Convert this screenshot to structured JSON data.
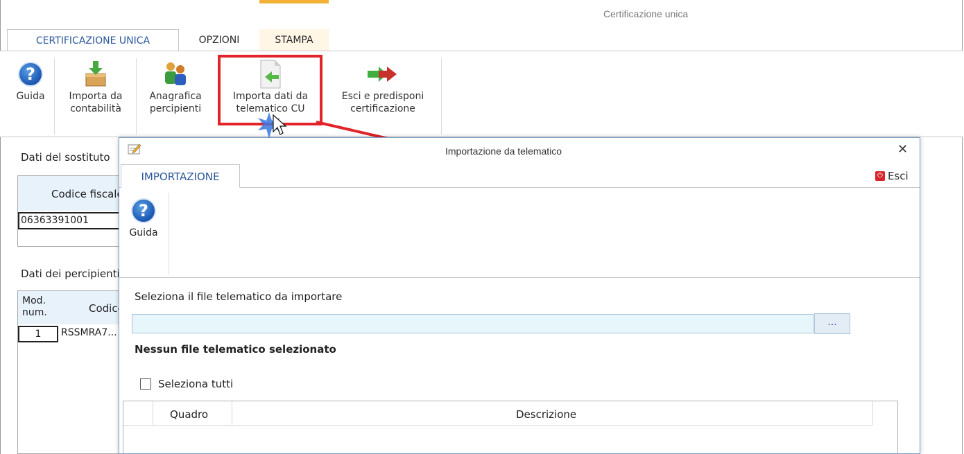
{
  "window": {
    "title": "Certificazione unica"
  },
  "ribbon": {
    "tabs": [
      "CERTIFICAZIONE UNICA",
      "OPZIONI",
      "STAMPA"
    ],
    "buttons": [
      {
        "label_line1": "Guida",
        "label_line2": "",
        "icon": "help-icon"
      },
      {
        "label_line1": "Importa da",
        "label_line2": "contabilità",
        "icon": "import-box-icon"
      },
      {
        "label_line1": "Anagrafica",
        "label_line2": "percipienti",
        "icon": "people-icon"
      },
      {
        "label_line1": "Importa dati da",
        "label_line2": "telematico CU",
        "icon": "import-document-icon"
      },
      {
        "label_line1": "Esci e predisponi",
        "label_line2": "certificazione",
        "icon": "arrows-icon"
      }
    ]
  },
  "main": {
    "sostituto_label": "Dati del sostituto",
    "codice_fiscale_header": "Codice fiscale",
    "codice_fiscale_value": "06363391001",
    "percipienti_label": "Dati dei percipienti",
    "mod_num_header_l1": "Mod.",
    "mod_num_header_l2": "num.",
    "codice_header": "Codice",
    "row_num": "1",
    "row_code": "RSSMRA7..."
  },
  "dialog": {
    "title": "Importazione da telematico",
    "close_glyph": "✕",
    "tab": "IMPORTAZIONE",
    "exit_label": "Esci",
    "guida_label": "Guida",
    "select_prompt": "Seleziona il file telematico da importare",
    "file_value": "",
    "browse_label": "...",
    "status": "Nessun file telematico selezionato",
    "select_all_label": "Seleziona tutti",
    "grid_headers": [
      "Quadro",
      "Descrizione"
    ]
  },
  "colors": {
    "accent": "#2b579a",
    "highlight": "#e2232a",
    "input_bg": "#e6f6fb",
    "stampa_accent": "#f2b135"
  }
}
